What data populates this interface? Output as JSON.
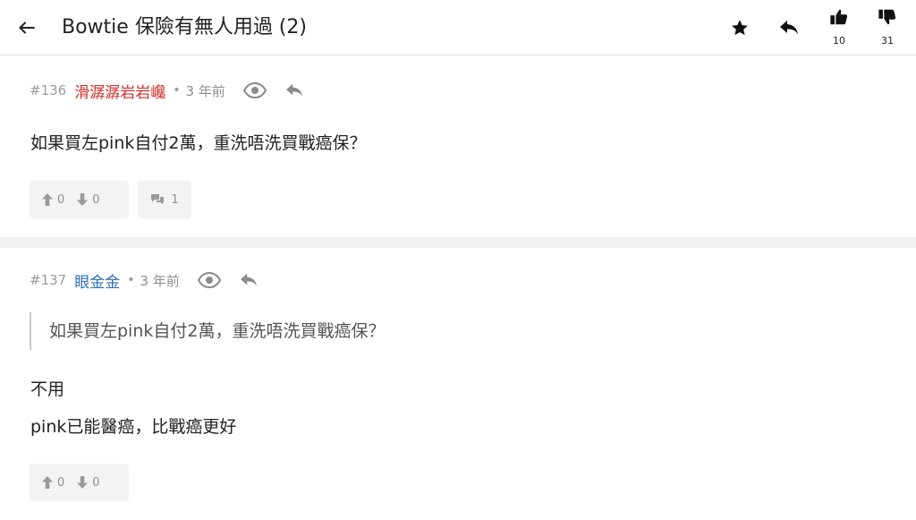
{
  "header": {
    "title": "Bowtie 保險有無人用過 (2)",
    "like_count": "10",
    "dislike_count": "31"
  },
  "posts": [
    {
      "number": "#136",
      "author": "滑潺潺岩岩巉",
      "author_color": "#d0312b",
      "separator": "•",
      "age": "3 年前",
      "lines": [
        "如果買左pink自付2萬，重洗唔洗買戰癌保？"
      ],
      "upvotes": "0",
      "downvotes": "0",
      "replies": "1"
    },
    {
      "number": "#137",
      "author": "眼金金",
      "author_color": "#2c6fb3",
      "separator": "•",
      "age": "3 年前",
      "quote": "如果買左pink自付2萬，重洗唔洗買戰癌保？",
      "lines": [
        "不用",
        "pink已能醫癌，比戰癌更好"
      ],
      "upvotes": "0",
      "downvotes": "0"
    }
  ],
  "icons": {
    "back": "arrow-left-icon",
    "star": "star-icon",
    "reply": "reply-icon",
    "like": "thumbs-up-icon",
    "dislike": "thumbs-down-icon",
    "view": "eye-icon",
    "upvote": "arrow-up-icon",
    "downvote": "arrow-down-icon",
    "comments": "comments-icon"
  }
}
